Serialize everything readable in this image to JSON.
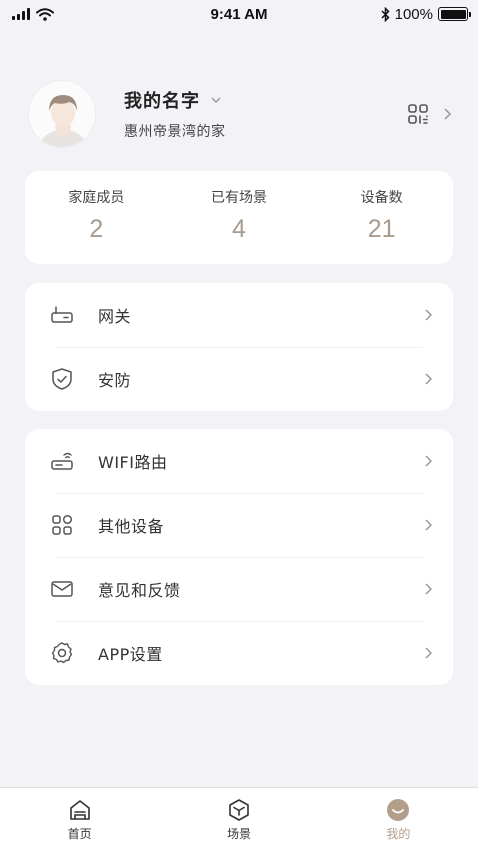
{
  "status_bar": {
    "time": "9:41 AM",
    "battery": "100%"
  },
  "profile": {
    "name": "我的名字",
    "home": "惠州帝景湾的家"
  },
  "stats": [
    {
      "label": "家庭成员",
      "value": "2"
    },
    {
      "label": "已有场景",
      "value": "4"
    },
    {
      "label": "设备数",
      "value": "21"
    }
  ],
  "menu_group_1": [
    {
      "label": "网关",
      "icon": "gateway-icon"
    },
    {
      "label": "安防",
      "icon": "shield-icon"
    }
  ],
  "menu_group_2": [
    {
      "label": "WIFI路由",
      "icon": "router-icon"
    },
    {
      "label": "其他设备",
      "icon": "devices-icon"
    },
    {
      "label": "意见和反馈",
      "icon": "mail-icon"
    },
    {
      "label": "APP设置",
      "icon": "gear-icon"
    }
  ],
  "tabs": [
    {
      "label": "首页",
      "icon": "home-icon"
    },
    {
      "label": "场景",
      "icon": "scene-cube-icon"
    },
    {
      "label": "我的",
      "icon": "smile-face-icon",
      "active": true
    }
  ],
  "colors": {
    "accent": "#b39e8c",
    "stat_value": "#a79b90",
    "background": "#f3f3f7"
  }
}
